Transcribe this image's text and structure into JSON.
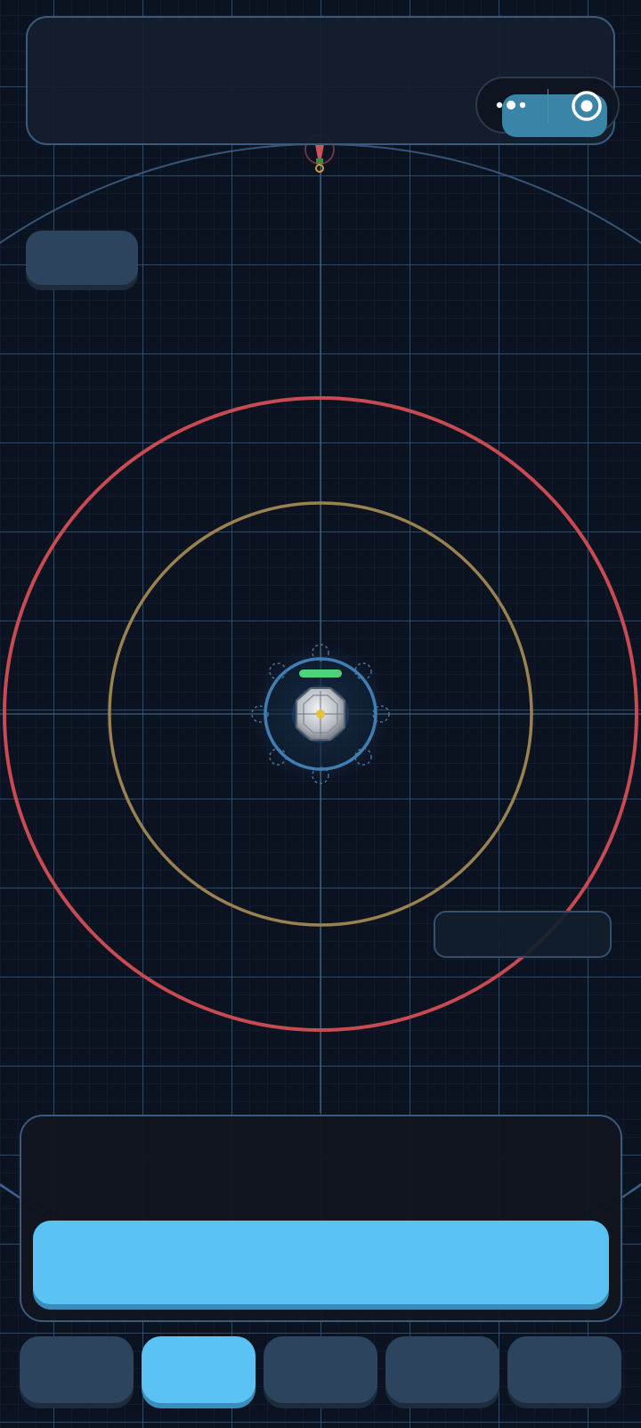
{
  "game": {
    "icons": {
      "menu": "more-dots-icon",
      "target": "target-icon",
      "station": "space-station-icon",
      "enemy_ship": "enemy-ship-icon"
    },
    "colors": {
      "background": "#0b1220",
      "grid_minor": "#1b2a40",
      "grid_major": "#2c4a6a",
      "range_red": "#c84a52",
      "range_gold": "#9a8250",
      "station_ring": "#3f7fb5",
      "health_bar": "#4dd37a",
      "accent": "#5bc2f4",
      "tab_idle": "#2c445d",
      "panel_border": "#3a5a80"
    },
    "station": {
      "health_fraction": 1.0,
      "slots_count": 8
    },
    "tabs": {
      "count": 5,
      "active_index": 1
    }
  }
}
